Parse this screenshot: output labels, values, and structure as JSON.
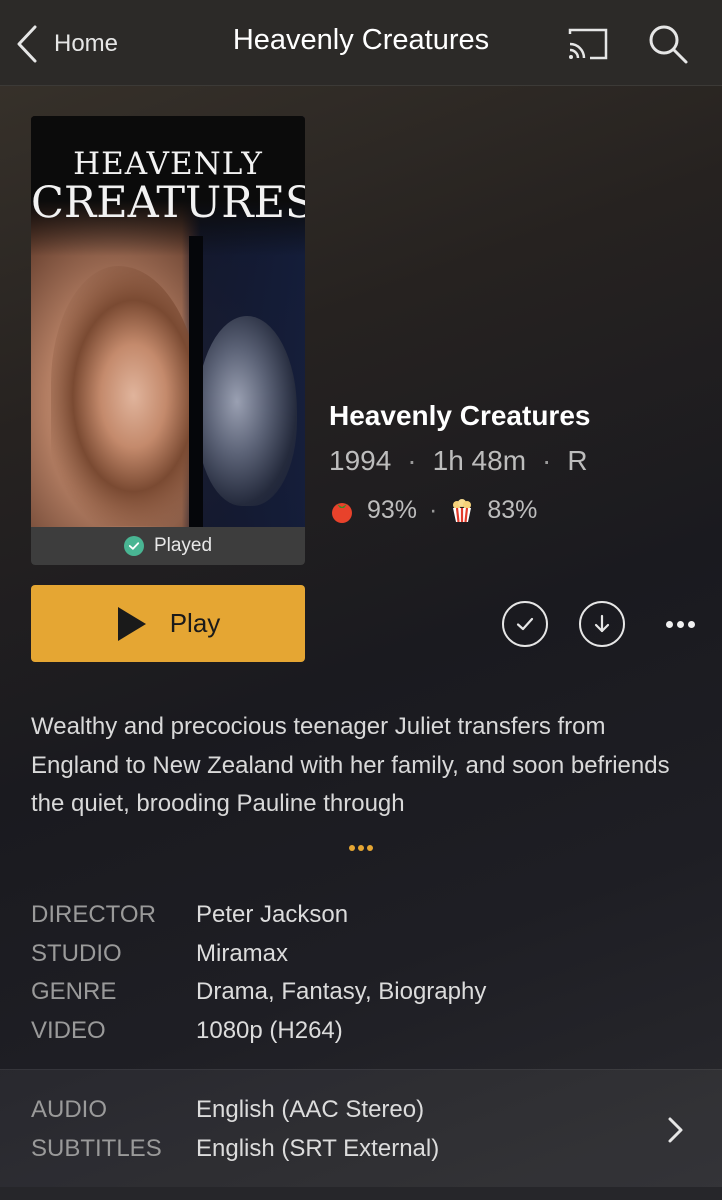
{
  "nav": {
    "back_label": "Home",
    "title": "Heavenly Creatures"
  },
  "poster": {
    "title_line1": "HEAVENLY",
    "title_line2": "CREATURES",
    "played_label": "Played"
  },
  "meta": {
    "title": "Heavenly Creatures",
    "year": "1994",
    "duration": "1h 48m",
    "rating": "R",
    "critic_score": "93%",
    "audience_score": "83%"
  },
  "actions": {
    "play_label": "Play"
  },
  "summary": "Wealthy and precocious teenager Juliet transfers from England to New Zealand with her family, and soon befriends the quiet, brooding Pauline through",
  "details": [
    {
      "key": "DIRECTOR",
      "value": "Peter Jackson"
    },
    {
      "key": "STUDIO",
      "value": "Miramax"
    },
    {
      "key": "GENRE",
      "value": "Drama, Fantasy, Biography"
    },
    {
      "key": "VIDEO",
      "value": "1080p (H264)"
    }
  ],
  "streams": [
    {
      "key": "AUDIO",
      "value": "English (AAC Stereo)"
    },
    {
      "key": "SUBTITLES",
      "value": "English (SRT External)"
    }
  ],
  "colors": {
    "accent": "#e5a633",
    "played": "#49b593",
    "tomato": "#e8422b",
    "popcorn": "#e23b2b"
  },
  "icons": {
    "back": "chevron-left-icon",
    "cast": "cast-icon",
    "search": "search-icon",
    "played": "check-circle-icon",
    "critic": "tomato-icon",
    "audience": "popcorn-icon",
    "play": "play-icon",
    "watched": "check-icon",
    "download": "download-icon",
    "more": "more-icon",
    "streams": "chevron-right-icon"
  }
}
